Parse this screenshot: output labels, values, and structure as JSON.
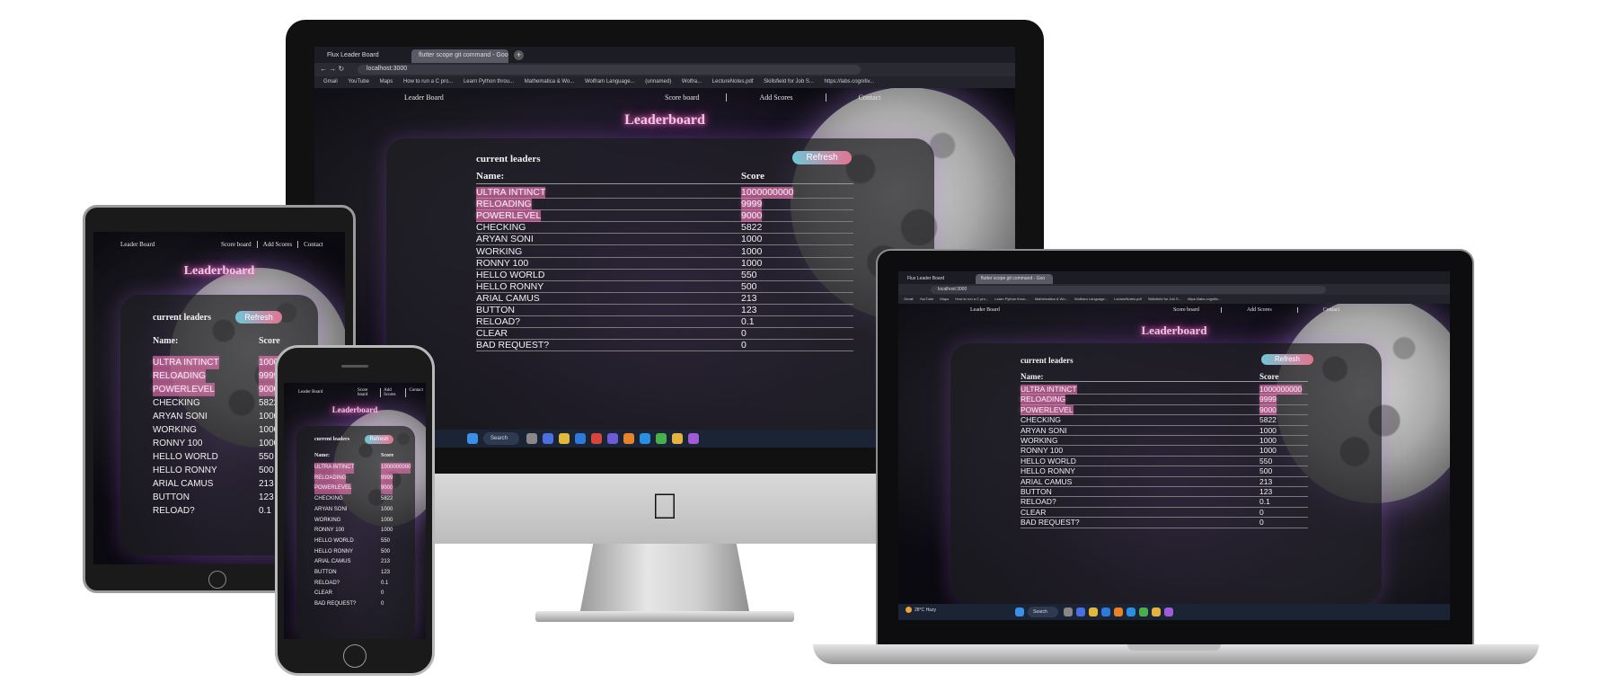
{
  "browser": {
    "tabs": [
      "Flux Leader Board",
      "flutter scope git command - Goo"
    ],
    "url": "localhost:3000",
    "bookmarks": [
      "Gmail",
      "YouTube",
      "Maps",
      "How to run a C pro...",
      "Learn Python throu...",
      "Mathematica & Wo...",
      "Wolfram Language...",
      "(unnamed)",
      "Wolfra...",
      "LectureNotes.pdf",
      "Skillsfield for Job S...",
      "https://labs.cognitiv..."
    ]
  },
  "app": {
    "brand": "Leader Board",
    "nav_links": [
      "Score board",
      "Add Scores",
      "Contact"
    ],
    "title": "Leaderboard",
    "panel_title": "current leaders",
    "refresh_label": "Refresh",
    "col_name": "Name:",
    "col_score": "Score",
    "rows": [
      {
        "name": "ULTRA INTINCT",
        "score": "1000000000"
      },
      {
        "name": "RELOADING",
        "score": "9999"
      },
      {
        "name": "POWERLEVEL",
        "score": "9000"
      },
      {
        "name": "CHECKING",
        "score": "5822"
      },
      {
        "name": "ARYAN SONI",
        "score": "1000"
      },
      {
        "name": "WORKING",
        "score": "1000"
      },
      {
        "name": "RONNY 100",
        "score": "1000"
      },
      {
        "name": "HELLO WORLD",
        "score": "550"
      },
      {
        "name": "HELLO RONNY",
        "score": "500"
      },
      {
        "name": "ARIAL CAMUS",
        "score": "213"
      },
      {
        "name": "BUTTON",
        "score": "123"
      },
      {
        "name": "RELOAD?",
        "score": "0.1"
      },
      {
        "name": "CLEAR",
        "score": "0"
      },
      {
        "name": "BAD REQUEST?",
        "score": "0"
      }
    ]
  },
  "taskbar": {
    "search_label": "Search",
    "weather_temp": "28°C",
    "weather_desc": "Hazy"
  },
  "colors": {
    "accent": "#ff6fc8",
    "refresh_start": "#6fc7d6",
    "refresh_end": "#e07690",
    "highlight": "#ff78be"
  }
}
